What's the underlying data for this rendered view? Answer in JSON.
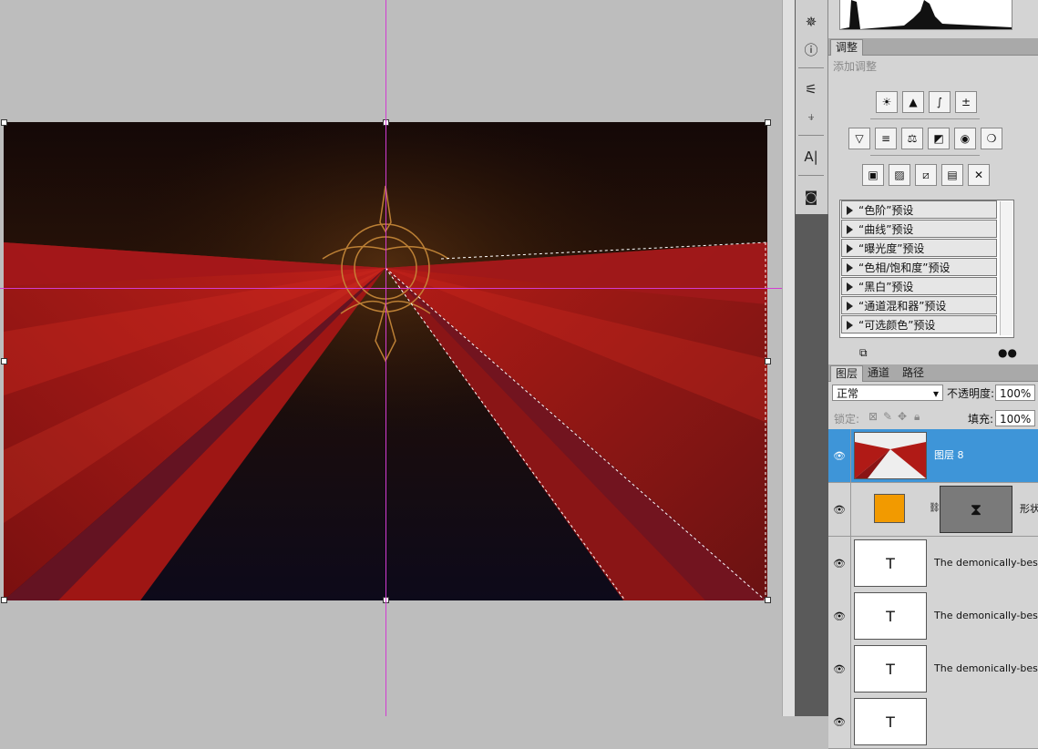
{
  "adjustments": {
    "tab": "调整",
    "subtitle": "添加调整",
    "icons_row1": [
      "brightness-icon",
      "levels-icon",
      "curves-icon",
      "exposure-icon"
    ],
    "icons_row2": [
      "vibrance-icon",
      "hue-saturation-icon",
      "color-balance-icon",
      "black-white-icon",
      "photo-filter-icon",
      "channel-mixer-icon"
    ],
    "icons_row3": [
      "invert-icon",
      "posterize-icon",
      "threshold-icon",
      "gradient-map-icon",
      "selective-color-icon"
    ],
    "presets": [
      "“色阶”预设",
      "“曲线”预设",
      "“曝光度”预设",
      "“色相/饱和度”预设",
      "“黑白”预设",
      "“通道混和器”预设",
      "“可选颜色”预设"
    ]
  },
  "layers_panel": {
    "tabs": [
      "图层",
      "通道",
      "路径"
    ],
    "blend_mode": "正常",
    "opacity_label": "不透明度:",
    "opacity_value": "100%",
    "lock_label": "锁定:",
    "fill_label": "填充:",
    "fill_value": "100%",
    "layers": [
      {
        "name": "图层 8",
        "selected": true
      },
      {
        "name": "形状",
        "selected": false
      },
      {
        "name": "The demonically-besiege",
        "thumb": "T",
        "selected": false
      },
      {
        "name": "The demonically-besiege",
        "thumb": "T",
        "selected": false
      },
      {
        "name": "The demonically-besiege",
        "thumb": "T",
        "selected": false
      },
      {
        "name": "",
        "thumb": "T",
        "selected": false
      }
    ]
  },
  "colors": {
    "selection": "#3e95d8",
    "guide": "#d23cd2",
    "shape_fill": "#f29a00"
  }
}
